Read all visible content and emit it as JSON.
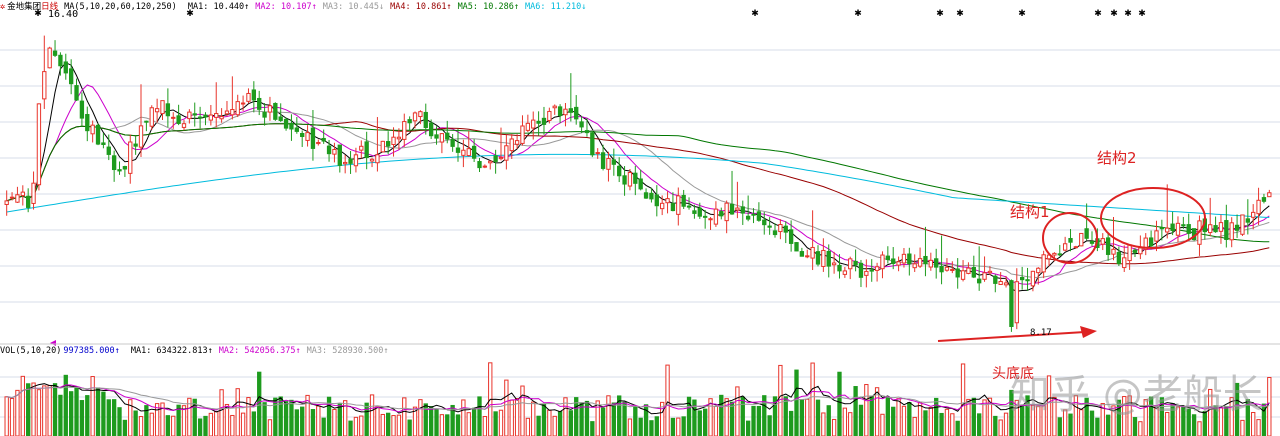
{
  "header": {
    "stock_name": "金地集团",
    "period": "日线",
    "ma_params": "MA(5,10,20,60,120,250)",
    "ma_values": [
      {
        "label": "MA1:",
        "value": "10.440↑",
        "color": "#000000"
      },
      {
        "label": "MA2:",
        "value": "10.107↑",
        "color": "#cc00cc"
      },
      {
        "label": "MA3:",
        "value": "10.445↓",
        "color": "#999999"
      },
      {
        "label": "MA4:",
        "value": "10.861↑",
        "color": "#990000"
      },
      {
        "label": "MA5:",
        "value": "10.286↑",
        "color": "#007700"
      },
      {
        "label": "MA6:",
        "value": "11.210↓",
        "color": "#00bbdd"
      }
    ]
  },
  "volume_header": {
    "params": "VOL(5,10,20)",
    "volume": "997385.000↑",
    "ma_values": [
      {
        "label": "MA1:",
        "value": "634322.813↑",
        "color": "#000000"
      },
      {
        "label": "MA2:",
        "value": "542056.375↑",
        "color": "#cc00cc"
      },
      {
        "label": "MA3:",
        "value": "528930.500↑",
        "color": "#999999"
      }
    ]
  },
  "annotations": {
    "high_label": "16.40",
    "low_label": "8.17",
    "structure1": "结构1",
    "structure2": "结构2",
    "head_bottom": "头底底",
    "watermark": "知乎 @老船长"
  },
  "colors": {
    "up": "#e8342b",
    "down": "#1e9b1e",
    "ma5": "#000000",
    "ma10": "#cc00cc",
    "ma20": "#999999",
    "ma60": "#990000",
    "ma120": "#007700",
    "ma250": "#00bbdd",
    "annotation": "#dd2222"
  },
  "chart_data": {
    "type": "candlestick",
    "title": "金地集团 日线",
    "indicators": [
      "MA5",
      "MA10",
      "MA20",
      "MA60",
      "MA120",
      "MA250",
      "VOL(5,10,20)"
    ],
    "price_range": [
      8,
      17
    ],
    "price_keypoints": [
      {
        "pos": 0.0,
        "price": 11.7
      },
      {
        "pos": 0.02,
        "price": 11.9
      },
      {
        "pos": 0.03,
        "price": 16.4
      },
      {
        "pos": 0.07,
        "price": 13.6
      },
      {
        "pos": 0.09,
        "price": 12.7
      },
      {
        "pos": 0.12,
        "price": 14.6
      },
      {
        "pos": 0.15,
        "price": 13.9
      },
      {
        "pos": 0.19,
        "price": 14.6
      },
      {
        "pos": 0.24,
        "price": 13.5
      },
      {
        "pos": 0.26,
        "price": 13.0
      },
      {
        "pos": 0.3,
        "price": 13.3
      },
      {
        "pos": 0.32,
        "price": 14.2
      },
      {
        "pos": 0.35,
        "price": 13.5
      },
      {
        "pos": 0.38,
        "price": 12.8
      },
      {
        "pos": 0.42,
        "price": 14.1
      },
      {
        "pos": 0.44,
        "price": 14.4
      },
      {
        "pos": 0.47,
        "price": 13.0
      },
      {
        "pos": 0.51,
        "price": 12.0
      },
      {
        "pos": 0.55,
        "price": 11.5
      },
      {
        "pos": 0.59,
        "price": 11.5
      },
      {
        "pos": 0.63,
        "price": 10.5
      },
      {
        "pos": 0.67,
        "price": 9.9
      },
      {
        "pos": 0.72,
        "price": 10.3
      },
      {
        "pos": 0.8,
        "price": 9.5
      },
      {
        "pos": 0.85,
        "price": 10.9
      },
      {
        "pos": 0.88,
        "price": 10.3
      },
      {
        "pos": 0.92,
        "price": 11.0
      },
      {
        "pos": 0.97,
        "price": 11.0
      },
      {
        "pos": 1.0,
        "price": 12.0
      }
    ],
    "high": 16.4,
    "low": 8.17,
    "last_ma": {
      "MA5": 10.44,
      "MA10": 10.107,
      "MA20": 10.445,
      "MA60": 10.861,
      "MA120": 10.286,
      "MA250": 11.21
    },
    "last_volume": 997385.0
  }
}
